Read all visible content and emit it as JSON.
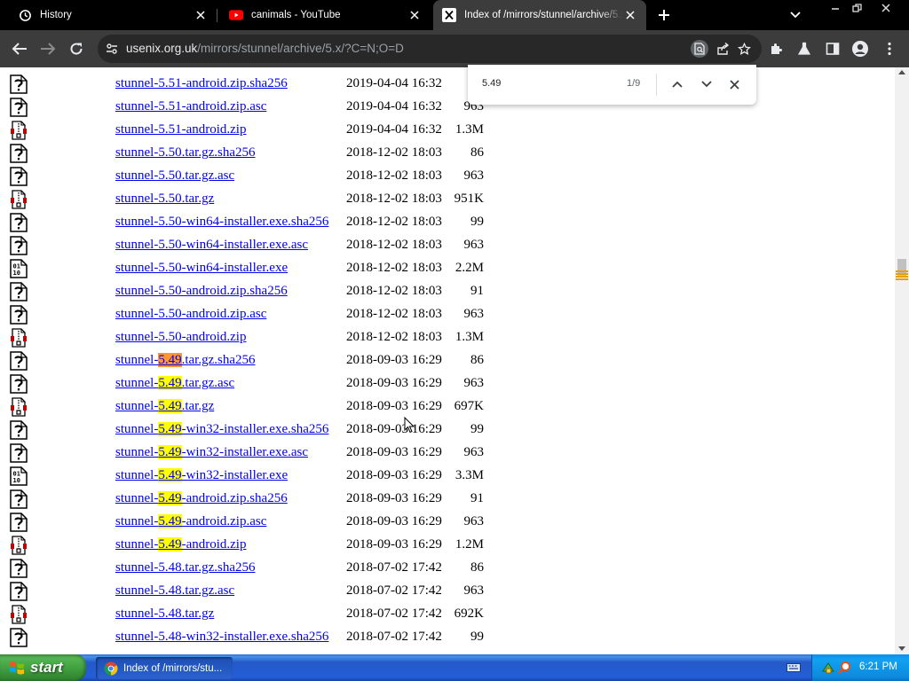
{
  "tabs": [
    {
      "title": "History",
      "icon": "history-icon",
      "active": false
    },
    {
      "title": "canimals - YouTube",
      "icon": "youtube-icon",
      "active": false
    },
    {
      "title": "Index of /mirrors/stunnel/archive/5.x/",
      "icon": "x-logo-icon",
      "active": true
    }
  ],
  "address_bar": {
    "domain": "usenix.org.uk",
    "path": "/mirrors/stunnel/archive/5.x/?C=N;O=D"
  },
  "find_bar": {
    "query": "5.49",
    "count": "1/9"
  },
  "files": [
    {
      "pre": "stunnel-5.51-android.zip.sha256",
      "match": "",
      "post": "",
      "date": "2019-04-04 16:32",
      "size": "",
      "icon": "unknown-file-icon"
    },
    {
      "pre": "stunnel-5.51-android.zip.asc",
      "match": "",
      "post": "",
      "date": "2019-04-04 16:32",
      "size": "963",
      "icon": "unknown-file-icon"
    },
    {
      "pre": "stunnel-5.51-android.zip",
      "match": "",
      "post": "",
      "date": "2019-04-04 16:32",
      "size": "1.3M",
      "icon": "compressed-file-icon"
    },
    {
      "pre": "stunnel-5.50.tar.gz.sha256",
      "match": "",
      "post": "",
      "date": "2018-12-02 18:03",
      "size": "86",
      "icon": "unknown-file-icon"
    },
    {
      "pre": "stunnel-5.50.tar.gz.asc",
      "match": "",
      "post": "",
      "date": "2018-12-02 18:03",
      "size": "963",
      "icon": "unknown-file-icon"
    },
    {
      "pre": "stunnel-5.50.tar.gz",
      "match": "",
      "post": "",
      "date": "2018-12-02 18:03",
      "size": "951K",
      "icon": "compressed-file-icon"
    },
    {
      "pre": "stunnel-5.50-win64-installer.exe.sha256",
      "match": "",
      "post": "",
      "date": "2018-12-02 18:03",
      "size": "99",
      "icon": "unknown-file-icon"
    },
    {
      "pre": "stunnel-5.50-win64-installer.exe.asc",
      "match": "",
      "post": "",
      "date": "2018-12-02 18:03",
      "size": "963",
      "icon": "unknown-file-icon"
    },
    {
      "pre": "stunnel-5.50-win64-installer.exe",
      "match": "",
      "post": "",
      "date": "2018-12-02 18:03",
      "size": "2.2M",
      "icon": "binary-file-icon"
    },
    {
      "pre": "stunnel-5.50-android.zip.sha256",
      "match": "",
      "post": "",
      "date": "2018-12-02 18:03",
      "size": "91",
      "icon": "unknown-file-icon"
    },
    {
      "pre": "stunnel-5.50-android.zip.asc",
      "match": "",
      "post": "",
      "date": "2018-12-02 18:03",
      "size": "963",
      "icon": "unknown-file-icon"
    },
    {
      "pre": "stunnel-5.50-android.zip",
      "match": "",
      "post": "",
      "date": "2018-12-02 18:03",
      "size": "1.3M",
      "icon": "compressed-file-icon"
    },
    {
      "pre": "stunnel-",
      "match": "5.49",
      "post": ".tar.gz.sha256",
      "current": true,
      "date": "2018-09-03 16:29",
      "size": "86",
      "icon": "unknown-file-icon"
    },
    {
      "pre": "stunnel-",
      "match": "5.49",
      "post": ".tar.gz.asc",
      "date": "2018-09-03 16:29",
      "size": "963",
      "icon": "unknown-file-icon"
    },
    {
      "pre": "stunnel-",
      "match": "5.49",
      "post": ".tar.gz",
      "date": "2018-09-03 16:29",
      "size": "697K",
      "icon": "compressed-file-icon"
    },
    {
      "pre": "stunnel-",
      "match": "5.49",
      "post": "-win32-installer.exe.sha256",
      "date": "2018-09-03 16:29",
      "size": "99",
      "icon": "unknown-file-icon"
    },
    {
      "pre": "stunnel-",
      "match": "5.49",
      "post": "-win32-installer.exe.asc",
      "date": "2018-09-03 16:29",
      "size": "963",
      "icon": "unknown-file-icon"
    },
    {
      "pre": "stunnel-",
      "match": "5.49",
      "post": "-win32-installer.exe",
      "date": "2018-09-03 16:29",
      "size": "3.3M",
      "icon": "binary-file-icon"
    },
    {
      "pre": "stunnel-",
      "match": "5.49",
      "post": "-android.zip.sha256",
      "date": "2018-09-03 16:29",
      "size": "91",
      "icon": "unknown-file-icon"
    },
    {
      "pre": "stunnel-",
      "match": "5.49",
      "post": "-android.zip.asc",
      "date": "2018-09-03 16:29",
      "size": "963",
      "icon": "unknown-file-icon"
    },
    {
      "pre": "stunnel-",
      "match": "5.49",
      "post": "-android.zip",
      "date": "2018-09-03 16:29",
      "size": "1.2M",
      "icon": "compressed-file-icon"
    },
    {
      "pre": "stunnel-5.48.tar.gz.sha256",
      "match": "",
      "post": "",
      "date": "2018-07-02 17:42",
      "size": "86",
      "icon": "unknown-file-icon"
    },
    {
      "pre": "stunnel-5.48.tar.gz.asc",
      "match": "",
      "post": "",
      "date": "2018-07-02 17:42",
      "size": "963",
      "icon": "unknown-file-icon"
    },
    {
      "pre": "stunnel-5.48.tar.gz",
      "match": "",
      "post": "",
      "date": "2018-07-02 17:42",
      "size": "692K",
      "icon": "compressed-file-icon"
    },
    {
      "pre": "stunnel-5.48-win32-installer.exe.sha256",
      "match": "",
      "post": "",
      "date": "2018-07-02 17:42",
      "size": "99",
      "icon": "unknown-file-icon"
    }
  ],
  "taskbar": {
    "start_label": "start",
    "task_label": "Index of /mirrors/stu...",
    "clock": "6:21 PM"
  },
  "colors": {
    "find_highlight": "#ffff00",
    "find_current": "#ff9632",
    "link": "#0000ee"
  }
}
